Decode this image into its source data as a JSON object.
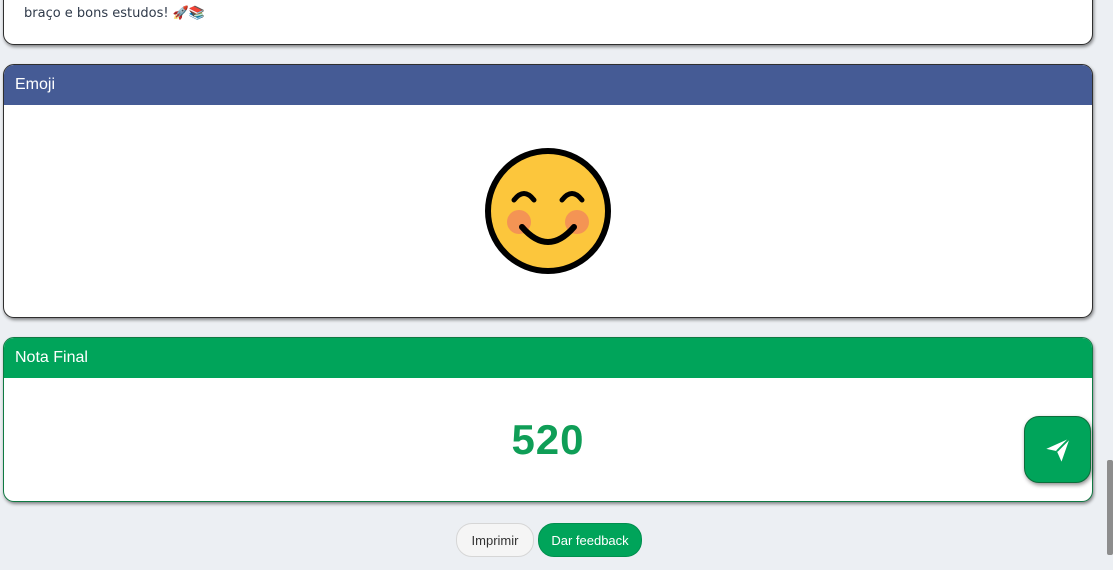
{
  "top_card": {
    "text": "braço e bons estudos! 🚀📚"
  },
  "emoji_card": {
    "title": "Emoji",
    "emoji_icon": "smiling-face-with-smiling-eyes"
  },
  "score_card": {
    "title": "Nota Final",
    "value": "520"
  },
  "fab": {
    "icon": "paper-plane-icon"
  },
  "buttons": {
    "print_label": "Imprimir",
    "feedback_label": "Dar feedback"
  },
  "colors": {
    "emoji_header": "#455b95",
    "score_header": "#00a45a",
    "score_text": "#0f9e57",
    "background": "#eceff3"
  }
}
